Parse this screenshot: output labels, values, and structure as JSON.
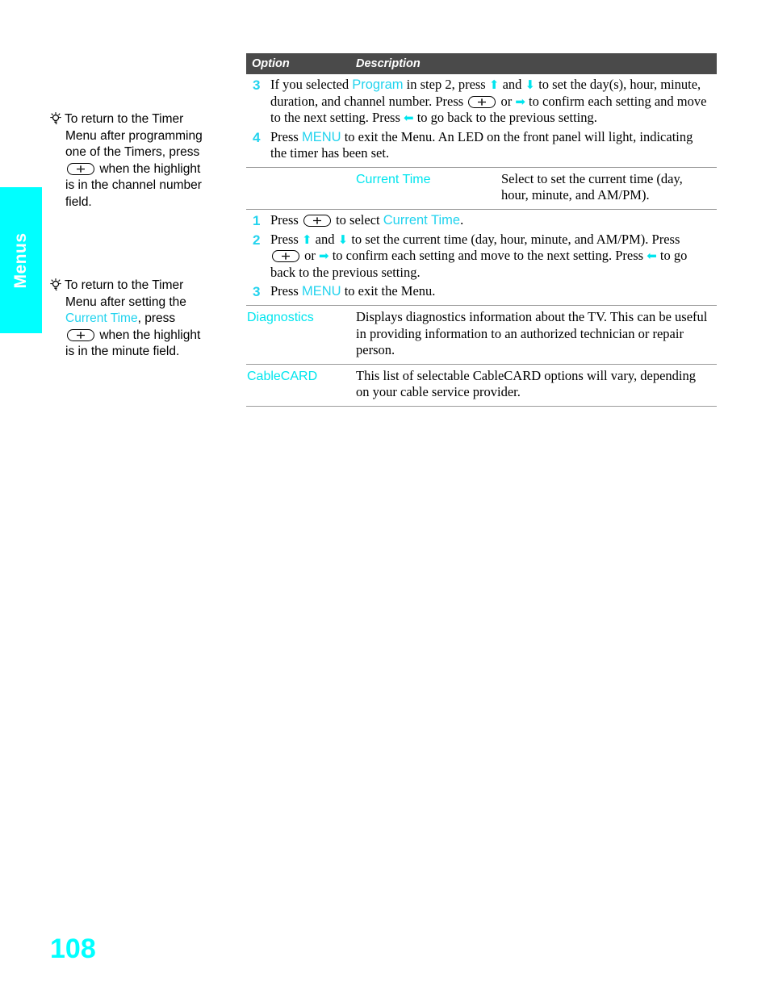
{
  "sidebar_tab": {
    "label": "Menus",
    "color": "#00ffff",
    "text_color": "#ffffff"
  },
  "notes": [
    {
      "icon": "lightbulb-tip-icon",
      "line1": "To return to the Timer",
      "line2": "Menu after programming",
      "line3": "one of the Timers, press",
      "key_icon": "enter-select-key-icon",
      "line4": "when the highlight",
      "line5": "is in the channel number",
      "line6": "field."
    },
    {
      "icon": "lightbulb-tip-icon",
      "line1": "To return to the Timer",
      "line2": "Menu after setting the",
      "highlight": "Current Time",
      "line3": ", press",
      "key_icon": "enter-select-key-icon",
      "line4": "when the highlight",
      "line5": "is in the minute field."
    }
  ],
  "table": {
    "header": {
      "option": "Option",
      "description": "Description"
    },
    "rows": [
      {
        "type": "steps",
        "steps": [
          {
            "num": "3",
            "parts": [
              {
                "t": "If you selected "
              },
              {
                "t": "Program",
                "style": "cyan"
              },
              {
                "t": " in step 2, press "
              },
              {
                "t": "↑",
                "style": "arrow-up"
              },
              {
                "t": " and "
              },
              {
                "t": "↓",
                "style": "arrow-down"
              },
              {
                "t": " to set the day(s), hour, minute, duration, and channel number. Press "
              },
              {
                "t": "",
                "style": "key"
              },
              {
                "t": " or "
              },
              {
                "t": "→",
                "style": "arrow-right"
              },
              {
                "t": " to confirm each setting and move to the next setting. Press "
              },
              {
                "t": "←",
                "style": "arrow-left"
              },
              {
                "t": " to go back to the previous setting."
              }
            ]
          },
          {
            "num": "4",
            "parts": [
              {
                "t": "Press "
              },
              {
                "t": "MENU",
                "style": "cyan-sans"
              },
              {
                "t": " to exit the Menu. An LED on the front panel will light, indicating the timer has been set."
              }
            ]
          }
        ]
      },
      {
        "type": "option",
        "option": "Current Time",
        "description": "Select to set the current time (day, hour, minute, and AM/PM)."
      },
      {
        "type": "steps",
        "steps": [
          {
            "num": "1",
            "parts": [
              {
                "t": "Press "
              },
              {
                "t": "",
                "style": "key"
              },
              {
                "t": " to select "
              },
              {
                "t": "Current Time",
                "style": "cyan-sans"
              },
              {
                "t": "."
              }
            ]
          },
          {
            "num": "2",
            "parts": [
              {
                "t": "Press "
              },
              {
                "t": "↑",
                "style": "arrow-up"
              },
              {
                "t": " and "
              },
              {
                "t": "↓",
                "style": "arrow-down"
              },
              {
                "t": " to set the current time (day, hour, minute, and AM/PM). Press "
              },
              {
                "t": "",
                "style": "key"
              },
              {
                "t": " or "
              },
              {
                "t": "→",
                "style": "arrow-right"
              },
              {
                "t": " to confirm each setting and move to the next setting. Press "
              },
              {
                "t": "←",
                "style": "arrow-left"
              },
              {
                "t": " to go back to the previous setting."
              }
            ]
          },
          {
            "num": "3",
            "parts": [
              {
                "t": "Press "
              },
              {
                "t": "MENU",
                "style": "cyan-sans"
              },
              {
                "t": " to exit the Menu."
              }
            ]
          }
        ]
      },
      {
        "type": "option",
        "option": "Diagnostics",
        "description": "Displays diagnostics information about the TV. This can be useful in providing information to an authorized technician or repair person."
      },
      {
        "type": "option",
        "option": "CableCARD",
        "description": "This list of selectable CableCARD options will vary, depending on your cable service provider."
      }
    ]
  },
  "page_number": "108",
  "colors": {
    "accent_cyan": "#00ffff",
    "term_cyan": "#00e5ee",
    "header_gray": "#4a4a4a",
    "rule_gray": "#9a9a9a"
  }
}
